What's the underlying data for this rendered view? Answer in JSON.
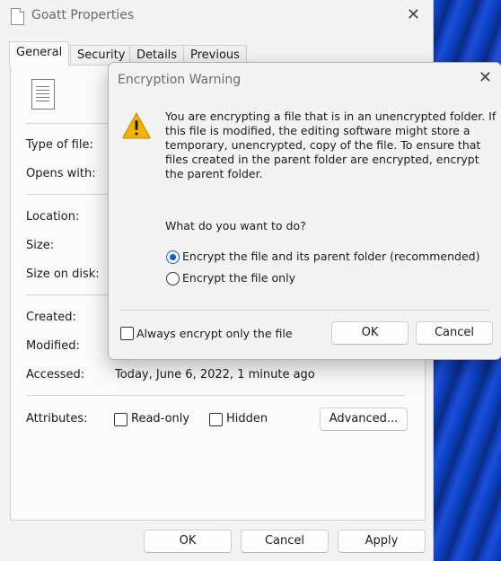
{
  "props": {
    "title": "Goatt Properties",
    "tabs": [
      "General",
      "Security",
      "Details",
      "Previous Versions"
    ],
    "labels": {
      "type_of_file": "Type of file:",
      "opens_with": "Opens with:",
      "location": "Location:",
      "size": "Size:",
      "size_on_disk": "Size on disk:",
      "created": "Created:",
      "modified": "Modified:",
      "accessed": "Accessed:",
      "attributes": "Attributes:"
    },
    "accessed_value": "Today, June 6, 2022, 1 minute ago",
    "readonly_label": "Read-only",
    "hidden_label": "Hidden",
    "advanced_label": "Advanced...",
    "ok_label": "OK",
    "cancel_label": "Cancel",
    "apply_label": "Apply"
  },
  "dialog": {
    "title": "Encryption Warning",
    "message": "You are encrypting a file that is in an unencrypted folder. If this file is modified, the editing software might store a temporary, unencrypted, copy of the file. To ensure that files created in the parent folder are encrypted, encrypt the parent folder.",
    "question": "What do you want to do?",
    "option_parent": "Encrypt the file and its parent folder (recommended)",
    "option_file": "Encrypt the file only",
    "always_label": "Always encrypt only the file",
    "ok_label": "OK",
    "cancel_label": "Cancel",
    "selected_option": "option_parent"
  },
  "colors": {
    "accent": "#0a5fc4",
    "warning": "#f2b200"
  }
}
